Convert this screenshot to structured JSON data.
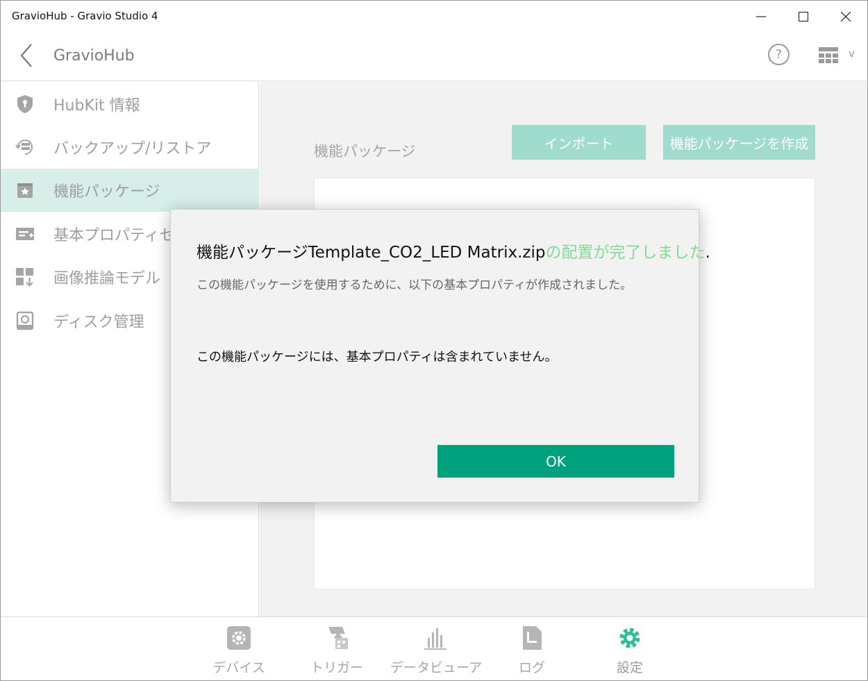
{
  "window": {
    "title": "GravioHub - Gravio Studio 4"
  },
  "header": {
    "title": "GravioHub",
    "help_label": "?",
    "layout_caret": "v"
  },
  "sidebar": {
    "items": [
      {
        "label": "HubKit 情報",
        "icon": "shield-icon"
      },
      {
        "label": "バックアップ/リストア",
        "icon": "backup-icon"
      },
      {
        "label": "機能パッケージ",
        "icon": "package-icon",
        "active": true
      },
      {
        "label": "基本プロパティセッ",
        "icon": "property-icon"
      },
      {
        "label": "画像推論モデル",
        "icon": "model-icon"
      },
      {
        "label": "ディスク管理",
        "icon": "disk-icon"
      }
    ]
  },
  "main": {
    "section_title": "機能パッケージ",
    "import_label": "インポート",
    "create_label": "機能パッケージを作成"
  },
  "dialog": {
    "heading_prefix": "機能パッケージTemplate_CO2_LED Matrix.zip",
    "heading_status": "の配置が完了しました",
    "heading_suffix": ".",
    "subtext": "この機能パッケージを使用するために、以下の基本プロパティが作成されました。",
    "note": "この機能パッケージには、基本プロパティは含まれていません。",
    "ok_label": "OK"
  },
  "bottom_nav": {
    "items": [
      {
        "label": "デバイス",
        "icon": "device-gear-icon"
      },
      {
        "label": "トリガー",
        "icon": "trigger-icon"
      },
      {
        "label": "データビューア",
        "icon": "chart-icon"
      },
      {
        "label": "ログ",
        "icon": "log-icon"
      },
      {
        "label": "設定",
        "icon": "settings-icon",
        "active": true
      }
    ]
  },
  "colors": {
    "accent": "#00a17d",
    "accent_light": "#9fdccd",
    "active_row": "#d8eee9",
    "success_text": "#7fdc92"
  }
}
